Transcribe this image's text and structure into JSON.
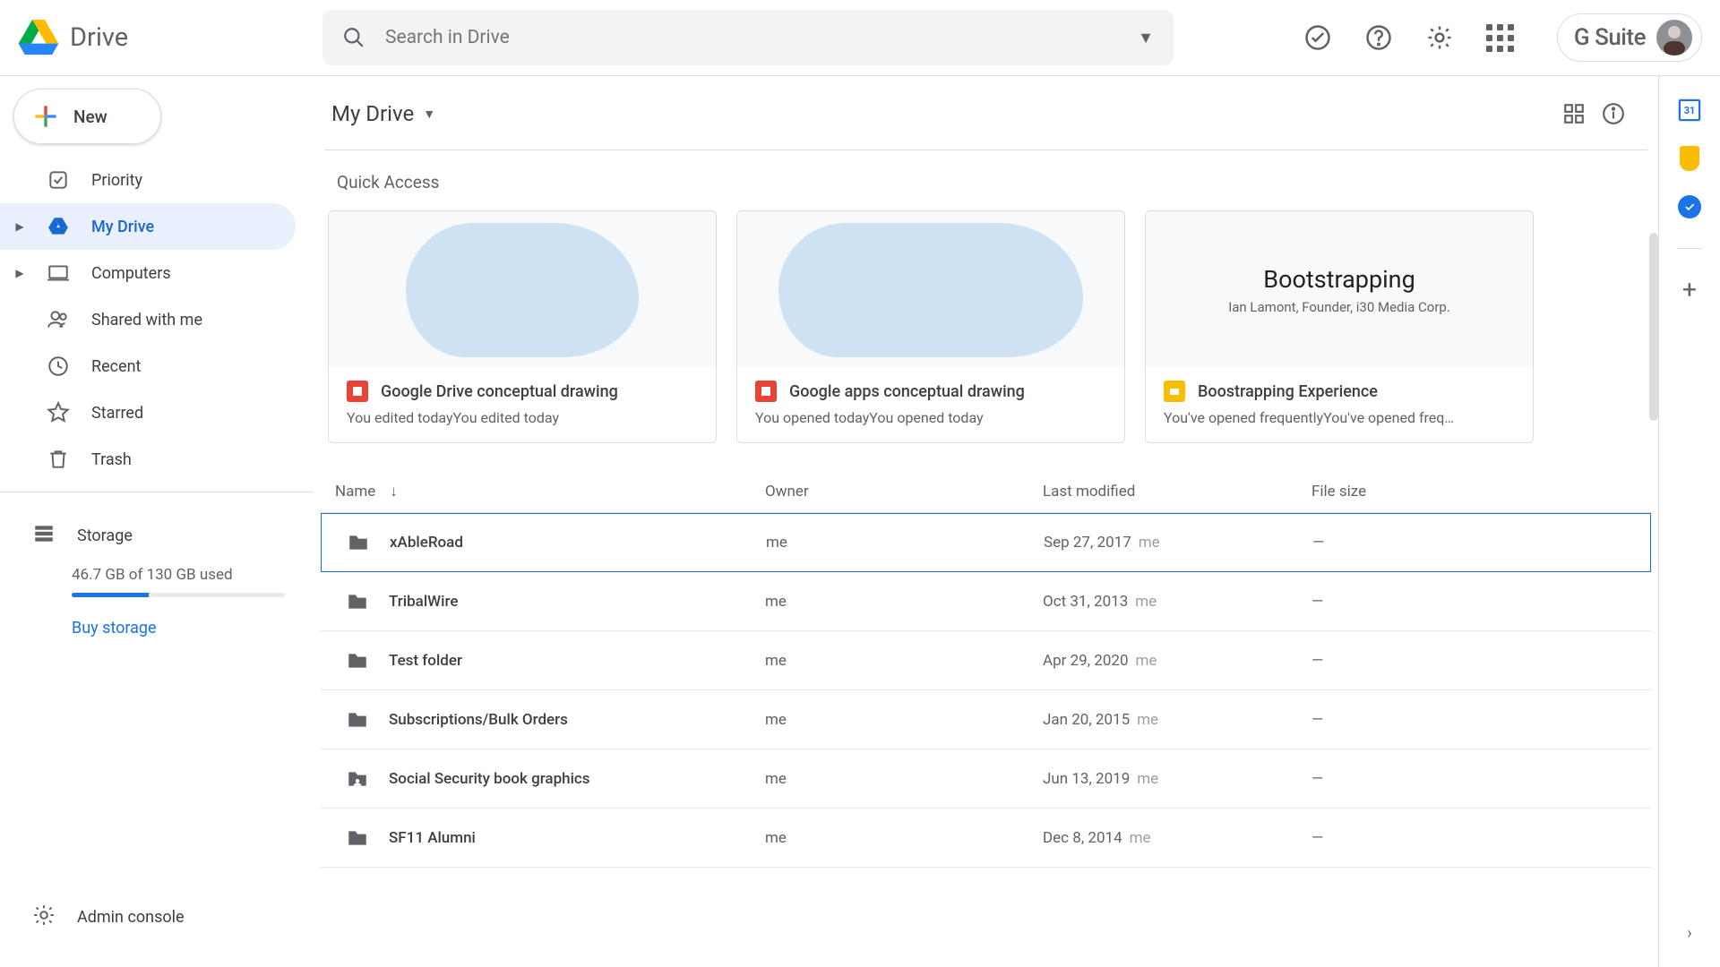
{
  "app": {
    "name": "Drive"
  },
  "search": {
    "placeholder": "Search in Drive"
  },
  "gsuite": "G Suite",
  "new_button": "New",
  "nav": {
    "priority": "Priority",
    "mydrive": "My Drive",
    "computers": "Computers",
    "shared": "Shared with me",
    "recent": "Recent",
    "starred": "Starred",
    "trash": "Trash",
    "storage": "Storage",
    "storage_usage": "46.7 GB of 130 GB used",
    "buy": "Buy storage",
    "admin": "Admin console"
  },
  "main": {
    "crumb": "My Drive",
    "quick_title": "Quick Access",
    "quick": [
      {
        "title": "Google Drive conceptual drawing",
        "subtitle": "You edited todayYou edited today",
        "chip": "red"
      },
      {
        "title": "Google apps conceptual drawing",
        "subtitle": "You opened todayYou opened today",
        "chip": "red"
      },
      {
        "title": "Boostrapping Experience",
        "subtitle": "You've opened frequentlyYou've opened freq…",
        "chip": "yellow",
        "boot_title": "Bootstrapping",
        "boot_sub": "Ian Lamont, Founder, i30 Media Corp."
      }
    ],
    "columns": {
      "name": "Name",
      "owner": "Owner",
      "modified": "Last modified",
      "size": "File size"
    },
    "rows": [
      {
        "name": "xAbleRoad",
        "owner": "me",
        "modified": "Sep 27, 2017",
        "who": "me",
        "size": "—",
        "shared": false
      },
      {
        "name": "TribalWire",
        "owner": "me",
        "modified": "Oct 31, 2013",
        "who": "me",
        "size": "—",
        "shared": false
      },
      {
        "name": "Test folder",
        "owner": "me",
        "modified": "Apr 29, 2020",
        "who": "me",
        "size": "—",
        "shared": false
      },
      {
        "name": "Subscriptions/Bulk Orders",
        "owner": "me",
        "modified": "Jan 20, 2015",
        "who": "me",
        "size": "—",
        "shared": false
      },
      {
        "name": "Social Security book graphics",
        "owner": "me",
        "modified": "Jun 13, 2019",
        "who": "me",
        "size": "—",
        "shared": true
      },
      {
        "name": "SF11 Alumni",
        "owner": "me",
        "modified": "Dec 8, 2014",
        "who": "me",
        "size": "—",
        "shared": false
      }
    ]
  },
  "rail": {
    "cal_day": "31"
  }
}
